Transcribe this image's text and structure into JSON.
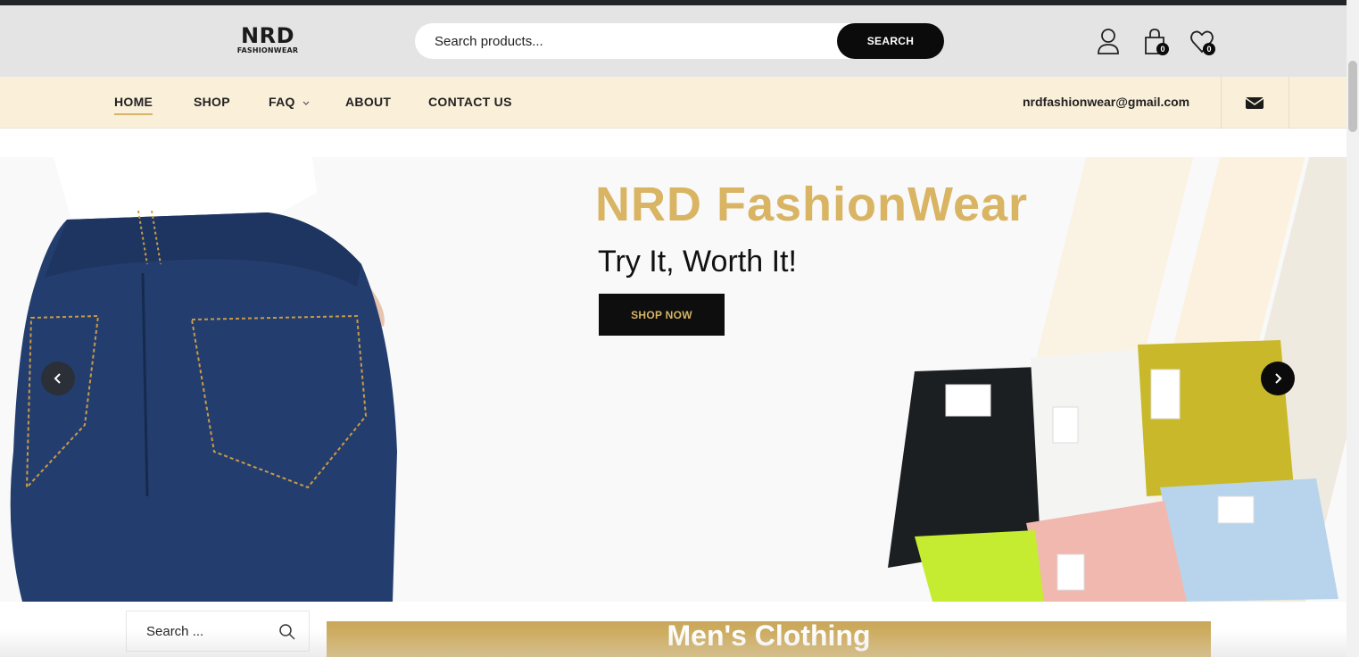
{
  "header": {
    "logo_main": "NRD",
    "logo_sub": "FASHIONWEAR",
    "search_placeholder": "Search products...",
    "search_button": "SEARCH",
    "cart_count": "0",
    "wishlist_count": "0"
  },
  "nav": {
    "items": [
      "HOME",
      "SHOP",
      "FAQ",
      "ABOUT",
      "CONTACT US"
    ],
    "email": "nrdfashionwear@gmail.com"
  },
  "hero": {
    "title": "NRD FashionWear",
    "subtitle": "Try It, Worth It!",
    "cta": "SHOP NOW"
  },
  "sidebar": {
    "search_placeholder": "Search ..."
  },
  "category": {
    "title": "Men's Clothing"
  },
  "colors": {
    "accent_gold": "#d8b463",
    "nav_background": "#faefd9",
    "header_background": "#e4e4e5",
    "dark": "#0b0b0b"
  }
}
